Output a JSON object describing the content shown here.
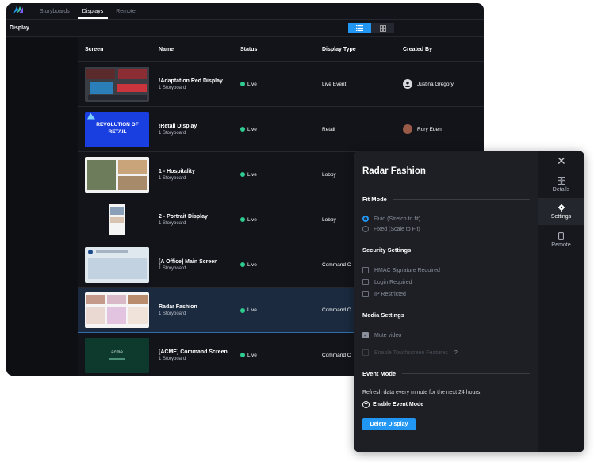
{
  "topnav": {
    "tabs": [
      {
        "label": "Storyboards"
      },
      {
        "label": "Displays"
      },
      {
        "label": "Remote"
      }
    ]
  },
  "subbar": {
    "title": "Display"
  },
  "table": {
    "headers": {
      "screen": "Screen",
      "name": "Name",
      "status": "Status",
      "type": "Display Type",
      "created": "Created By"
    },
    "rows": [
      {
        "name": "!Adaptation Red Display",
        "sub": "1 Storyboard",
        "status": "Live",
        "type": "Live Event",
        "created": "Justina Gregory"
      },
      {
        "name": "!Retail Display",
        "sub": "1 Storyboard",
        "status": "Live",
        "type": "Retail",
        "created": "Rory Eden",
        "thumb_text": "REVOLUTION OF RETAIL"
      },
      {
        "name": "1 - Hospitality",
        "sub": "1 Storyboard",
        "status": "Live",
        "type": "Lobby",
        "created": ""
      },
      {
        "name": "2 - Portrait Display",
        "sub": "1 Storyboard",
        "status": "Live",
        "type": "Lobby",
        "created": ""
      },
      {
        "name": "[A Office] Main Screen",
        "sub": "1 Storyboard",
        "status": "Live",
        "type": "Command C",
        "created": ""
      },
      {
        "name": "Radar Fashion",
        "sub": "1 Storyboard",
        "status": "Live",
        "type": "Command C",
        "created": ""
      },
      {
        "name": "[ACME] Command Screen",
        "sub": "1 Storyboard",
        "status": "Live",
        "type": "Command C",
        "created": "",
        "thumb_text": "acme"
      }
    ]
  },
  "panel": {
    "title": "Radar Fashion",
    "fit_mode": {
      "heading": "Fit Mode",
      "options": [
        {
          "label": "Fluid (Stretch to fit)",
          "selected": true
        },
        {
          "label": "Fixed (Scale to Fit)",
          "selected": false
        }
      ]
    },
    "security": {
      "heading": "Security Settings",
      "options": [
        {
          "label": "HMAC Signature Required",
          "checked": false
        },
        {
          "label": "Login Required",
          "checked": false
        },
        {
          "label": "IP Restricted",
          "checked": false
        }
      ]
    },
    "media": {
      "heading": "Media Settings",
      "options": [
        {
          "label": "Mute video",
          "checked": true
        },
        {
          "label": "Enable Touchscreen Features",
          "checked": false,
          "disabled": true
        }
      ],
      "help": "?"
    },
    "event_mode": {
      "heading": "Event Mode",
      "text": "Refresh data every minute for the next 24 hours.",
      "link": "Enable Event Mode"
    },
    "delete_button": "Delete Display",
    "rail": [
      {
        "label": "Details",
        "icon": "grid-icon"
      },
      {
        "label": "Settings",
        "icon": "gear-icon",
        "active": true
      },
      {
        "label": "Remote",
        "icon": "phone-icon"
      }
    ]
  },
  "colors": {
    "accent": "#2196f3",
    "live": "#2ecc8f",
    "bg": "#12141a",
    "panel": "#1d1f25"
  }
}
